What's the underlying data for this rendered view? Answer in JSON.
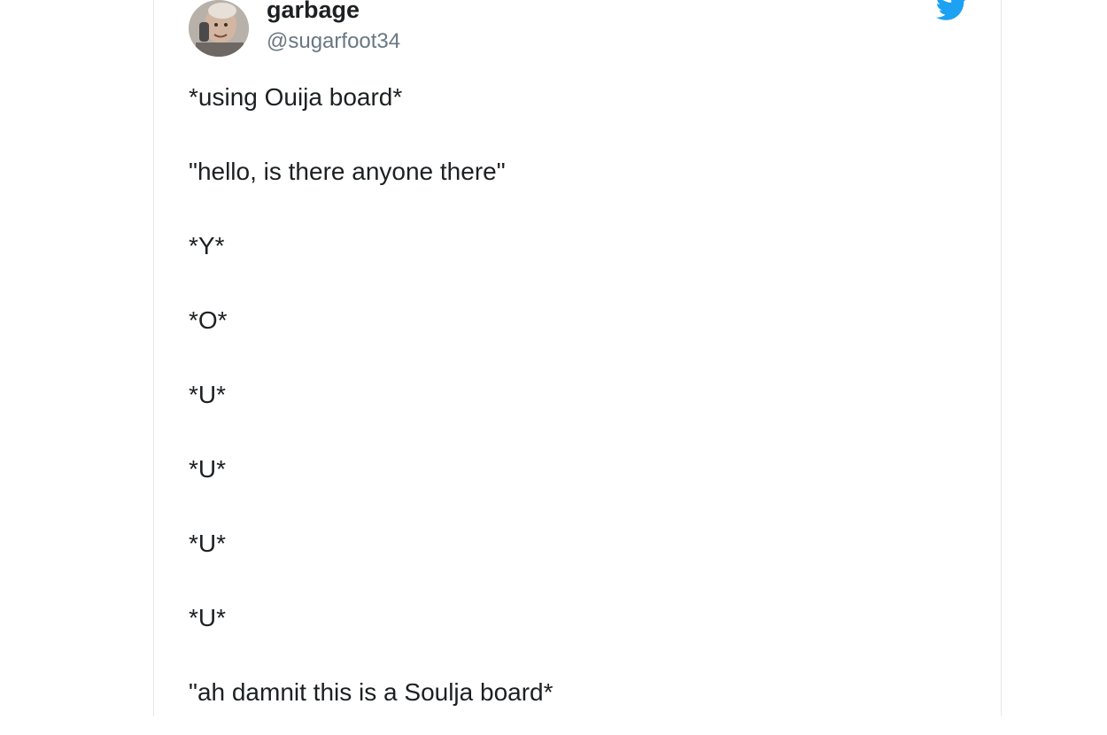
{
  "tweet": {
    "author": {
      "display_name": "garbage",
      "handle": "@sugarfoot34",
      "avatar_icon": "user-avatar"
    },
    "brand_icon": "twitter-bird-icon",
    "brand_color": "#1da1f2",
    "lines": [
      "*using Ouija board*",
      "\"hello, is there anyone there\"",
      "*Y*",
      "*O*",
      "*U*",
      "*U*",
      "*U*",
      "*U*",
      "\"ah damnit this is a Soulja board*"
    ]
  }
}
